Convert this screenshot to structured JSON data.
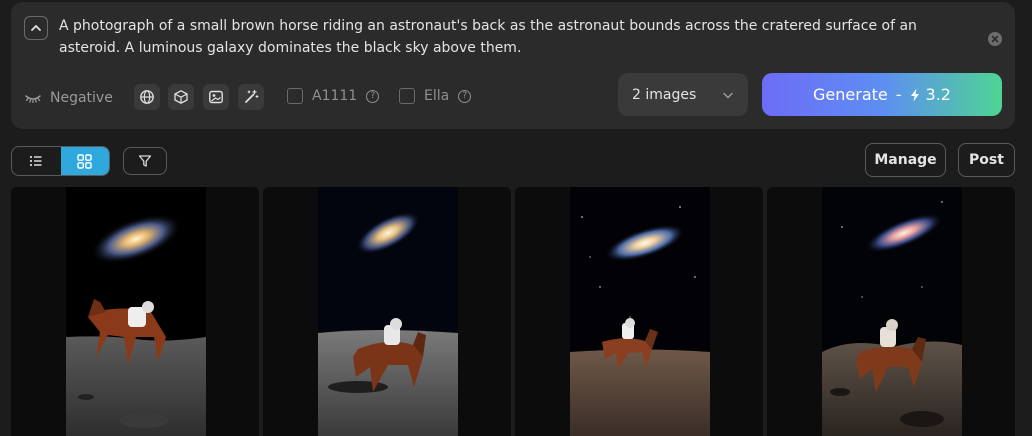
{
  "prompt": {
    "text": "A photograph of a small brown horse riding an astronaut's back as the astronaut bounds across the cratered surface of an asteroid. A luminous galaxy dominates the black sky above them."
  },
  "options": {
    "negative_label": "Negative",
    "a1111_label": "A1111",
    "ella_label": "Ella",
    "a1111_checked": false,
    "ella_checked": false
  },
  "image_count": {
    "selected": "2 images"
  },
  "generate": {
    "label": "Generate",
    "cost": "3.2"
  },
  "toolbar": {
    "manage_label": "Manage",
    "post_label": "Post",
    "active_view": "grid"
  },
  "gallery": {
    "images": [
      {
        "description": "astronaut riding brown horse on grey asteroid under spiral galaxy"
      },
      {
        "description": "astronaut riding brown horse on grey cratered surface under galaxy"
      },
      {
        "description": "astronaut riding brown horse on brown asteroid under galaxy"
      },
      {
        "description": "astronaut riding brown horse among rocks under spiral galaxy"
      }
    ]
  },
  "colors": {
    "accent": "#2fa9dd",
    "generate_start": "#6d6cf7",
    "generate_end": "#4fd494",
    "panel": "#2b2b2b",
    "background": "#1c1c1c"
  }
}
